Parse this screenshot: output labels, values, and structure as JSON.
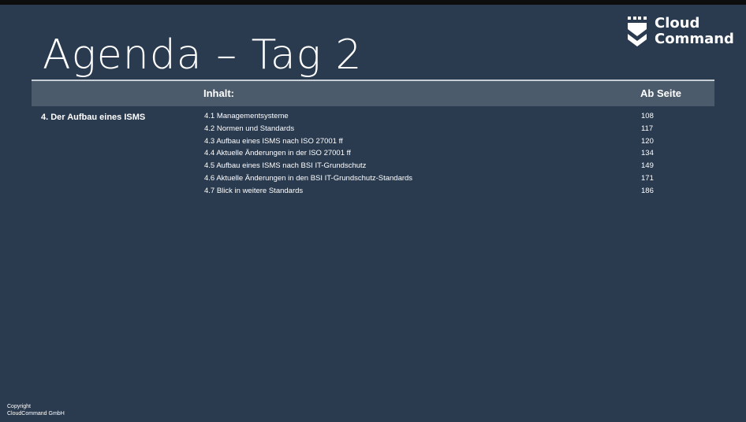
{
  "slide": {
    "title": "Agenda – Tag 2"
  },
  "logo": {
    "line1": "Cloud",
    "line2": "Command",
    "icon": "shield-chevron-icon"
  },
  "table": {
    "header_content": "Inhalt:",
    "header_page": "Ab Seite",
    "section": "4. Der Aufbau eines ISMS",
    "rows": [
      {
        "title": "4.1 Managementsysteme",
        "page": "108"
      },
      {
        "title": "4.2 Normen und Standards",
        "page": "117"
      },
      {
        "title": "4.3 Aufbau eines ISMS nach ISO 27001 ff",
        "page": "120"
      },
      {
        "title": "4.4 Aktuelle Änderungen in der ISO 27001 ff",
        "page": "134"
      },
      {
        "title": "4.5 Aufbau eines ISMS nach BSI IT-Grundschutz",
        "page": "149"
      },
      {
        "title": "4.6 Aktuelle Änderungen in den BSI IT-Grundschutz-Standards",
        "page": "171"
      },
      {
        "title": "4.7 Blick in weitere Standards",
        "page": "186"
      }
    ]
  },
  "footer": {
    "line1": "Copyright",
    "line2": "CloudCommand GmbH"
  },
  "colors": {
    "background": "#2a3b50",
    "header_bar": "#4b5b6c",
    "text": "#ffffff"
  }
}
